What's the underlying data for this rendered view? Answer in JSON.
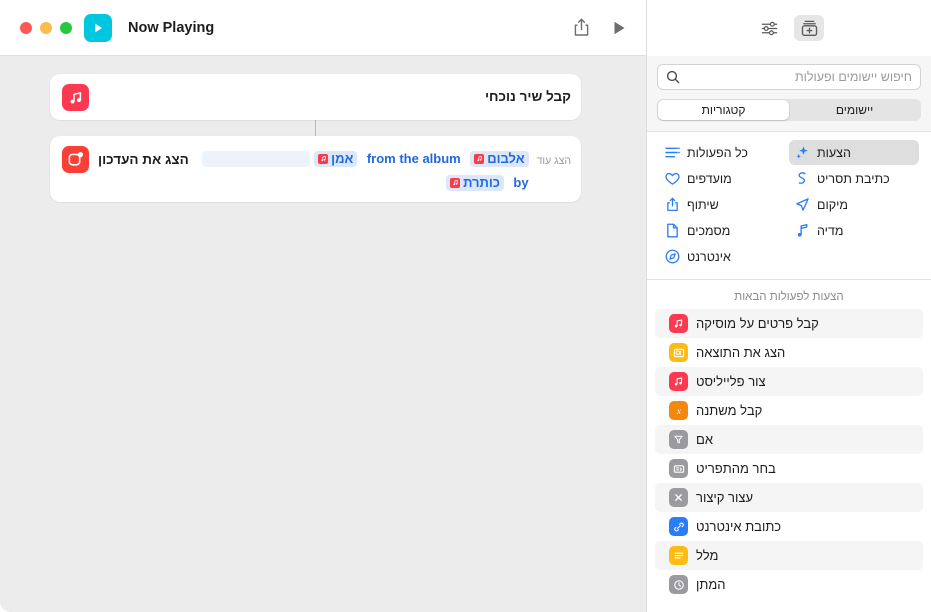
{
  "window": {
    "traffic_lights": [
      {
        "name": "close",
        "color": "#fb5a52"
      },
      {
        "name": "minimize",
        "color": "#f9bd4e"
      },
      {
        "name": "zoom",
        "color": "#25c83f"
      }
    ]
  },
  "library": {
    "toolbar": {
      "settings_icon": "sliders-icon",
      "add_action_icon": "add-action-icon"
    },
    "search": {
      "placeholder": "חיפוש יישומים ופעולות",
      "value": "",
      "icon": "search-icon"
    },
    "segmented": {
      "options": [
        {
          "label": "קטגוריות",
          "selected": true
        },
        {
          "label": "יישומים",
          "selected": false
        }
      ]
    },
    "categories": {
      "right_column": [
        {
          "label": "כל הפעולות",
          "icon": "list-icon",
          "selected": false
        },
        {
          "label": "מועדפים",
          "icon": "heart-icon",
          "selected": false
        },
        {
          "label": "שיתוף",
          "icon": "share-icon",
          "selected": false
        },
        {
          "label": "מסמכים",
          "icon": "document-icon",
          "selected": false
        },
        {
          "label": "אינטרנט",
          "icon": "compass-icon",
          "selected": false
        }
      ],
      "left_column": [
        {
          "label": "הצעות",
          "icon": "sparkles-icon",
          "selected": true
        },
        {
          "label": "כתיבת תסריט",
          "icon": "scripting-icon",
          "selected": false
        },
        {
          "label": "מיקום",
          "icon": "location-arrow-icon",
          "selected": false
        },
        {
          "label": "מדיה",
          "icon": "music-note-icon",
          "selected": false
        }
      ]
    },
    "suggestions": {
      "title": "הצעות לפעולות הבאות",
      "items": [
        {
          "label": "קבל פרטים על מוסיקה",
          "icon": "music-icon",
          "color": "#fb3a52"
        },
        {
          "label": "הצג את התוצאה",
          "icon": "quicklook-icon",
          "color": "#fdbc14"
        },
        {
          "label": "צור פלייליסט",
          "icon": "music-icon",
          "color": "#fb3a52"
        },
        {
          "label": "קבל משתנה",
          "icon": "variable-icon",
          "color": "#f5870f"
        },
        {
          "label": "אם",
          "icon": "filter-icon",
          "color": "#9b9b9f"
        },
        {
          "label": "בחר מהתפריט",
          "icon": "menu-icon",
          "color": "#9b9b9f"
        },
        {
          "label": "עצור קיצור",
          "icon": "stop-icon",
          "color": "#9b9b9f"
        },
        {
          "label": "כתובת אינטרנט",
          "icon": "link-icon",
          "color": "#2a7cf7"
        },
        {
          "label": "מלל",
          "icon": "text-icon",
          "color": "#fdbc14"
        },
        {
          "label": "המתן",
          "icon": "clock-icon",
          "color": "#9b9b9f"
        }
      ]
    }
  },
  "editor": {
    "toolbar": {
      "title": "Now Playing",
      "shortcut_glyph_color": "#00c7e0",
      "shortcut_glyph_icon": "play-glyph-icon",
      "run_icon": "play-icon",
      "share_icon": "share-icon"
    },
    "actions": [
      {
        "glyph_icon": "music-icon",
        "glyph_color": "#fb3a52",
        "title": "קבל שיר נוכחי",
        "tokens": [],
        "show_more": null
      },
      {
        "glyph_icon": "notification-icon",
        "glyph_color": "#fb3e36",
        "title": "הצג את העדכון",
        "show_more": "הצג עוד",
        "line1": {
          "tokens": [
            {
              "label": "אלבום",
              "icon": "music-token-icon"
            },
            {
              "text": "from the album",
              "lang": "en"
            },
            {
              "label": "אמן",
              "icon": "music-token-icon"
            }
          ]
        },
        "line2": {
          "tokens": [
            {
              "text": "by",
              "lang": "en"
            },
            {
              "label": "כותרת",
              "icon": "music-token-icon"
            }
          ]
        }
      }
    ]
  }
}
